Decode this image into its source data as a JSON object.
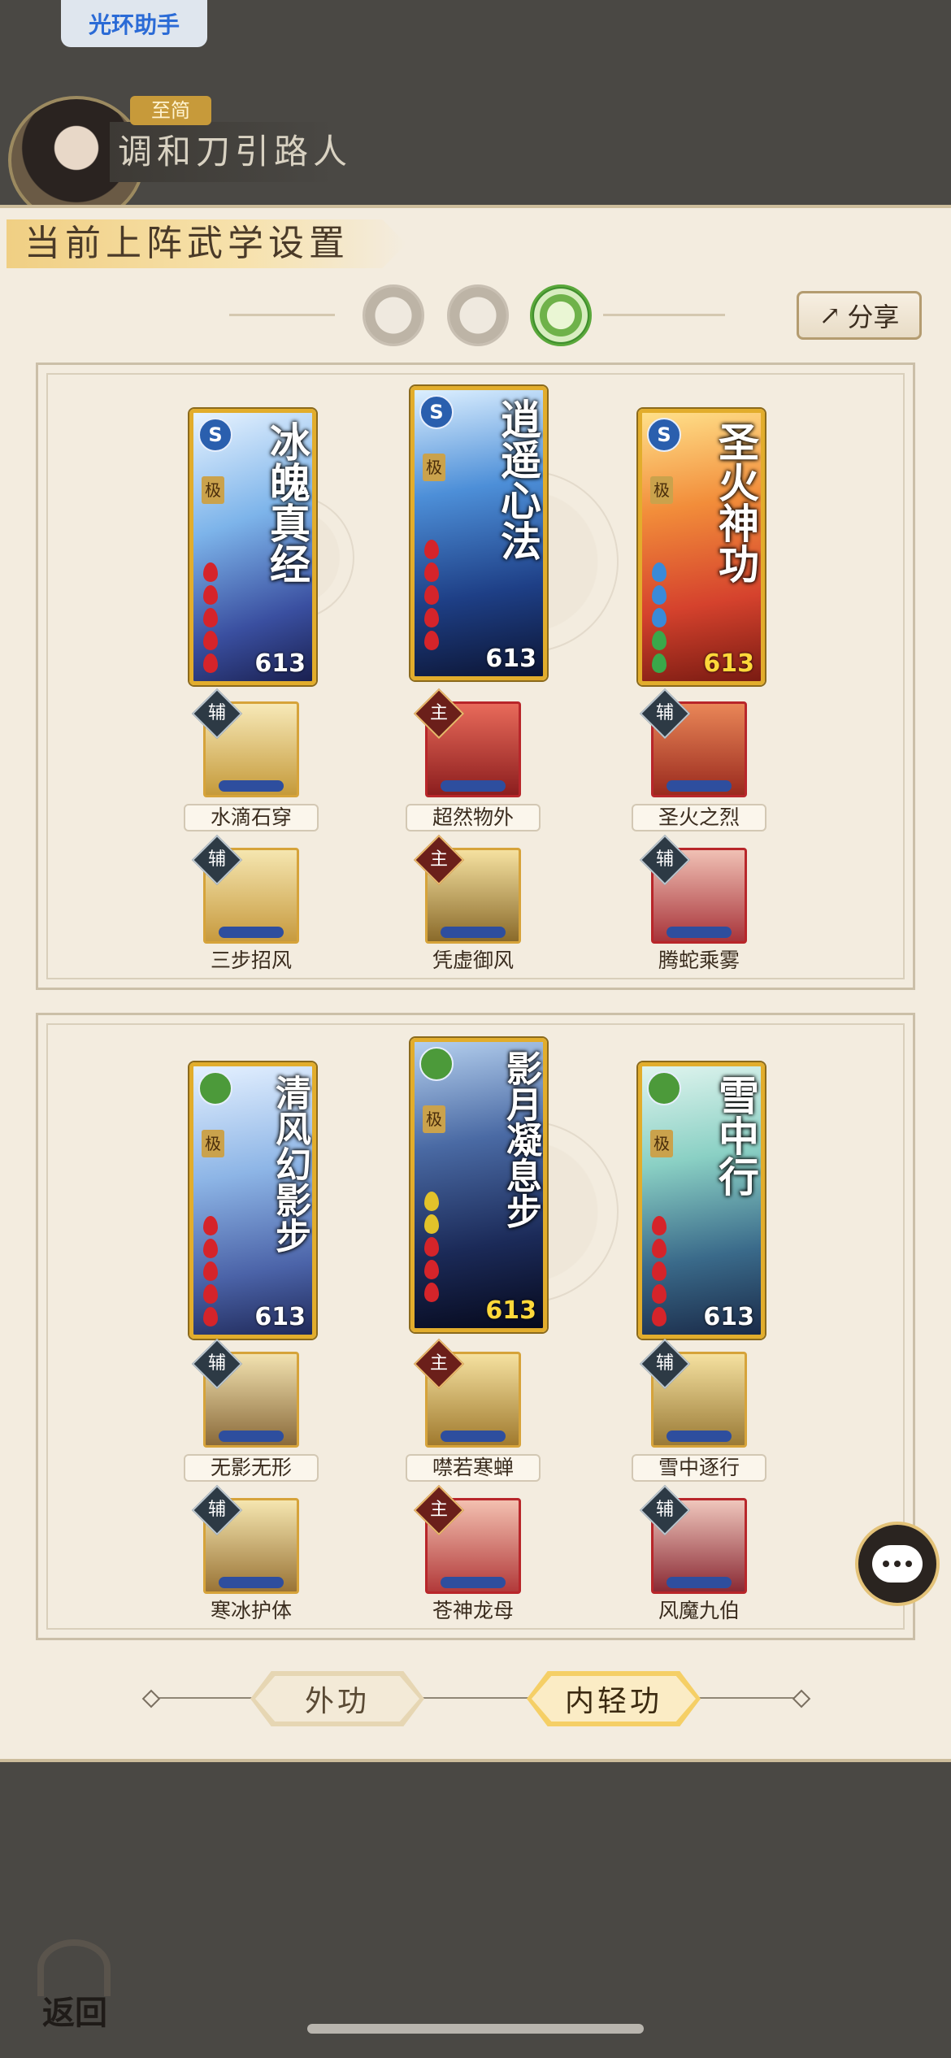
{
  "top": {
    "halo_button": "光环助手",
    "rank": "至简",
    "player_name": "调和刀引路人"
  },
  "panel": {
    "title": "当前上阵武学设置",
    "share_label": "分享",
    "mode_icons": [
      "moon-icon",
      "sun-icon",
      "jade-icon"
    ],
    "active_mode": 2
  },
  "sections": [
    {
      "cards": [
        {
          "name": "冰魄真经",
          "grade": "极",
          "level": "613",
          "badge": "S"
        },
        {
          "name": "逍遥心法",
          "grade": "极",
          "level": "613",
          "badge": "S"
        },
        {
          "name": "圣火神功",
          "grade": "极",
          "level": "613",
          "badge": "S"
        }
      ],
      "skills_row1": [
        {
          "tag": "辅",
          "label": "水滴石穿"
        },
        {
          "tag": "主",
          "label": "超然物外"
        },
        {
          "tag": "辅",
          "label": "圣火之烈"
        }
      ],
      "skills_row2": [
        {
          "tag": "辅",
          "label": "三步招风"
        },
        {
          "tag": "主",
          "label": "凭虚御风"
        },
        {
          "tag": "辅",
          "label": "腾蛇乘雾"
        }
      ]
    },
    {
      "cards": [
        {
          "name": "清风幻影步",
          "grade": "极",
          "level": "613"
        },
        {
          "name": "影月凝息步",
          "grade": "极",
          "level": "613"
        },
        {
          "name": "雪中行",
          "grade": "极",
          "level": "613"
        }
      ],
      "skills_row1": [
        {
          "tag": "辅",
          "label": "无影无形"
        },
        {
          "tag": "主",
          "label": "噤若寒蝉"
        },
        {
          "tag": "辅",
          "label": "雪中逐行"
        }
      ],
      "skills_row2": [
        {
          "tag": "辅",
          "label": "寒冰护体"
        },
        {
          "tag": "主",
          "label": "苍神龙母"
        },
        {
          "tag": "辅",
          "label": "风魔九伯"
        }
      ]
    }
  ],
  "bottom_tabs": {
    "outer": "外功",
    "inner": "内轻功",
    "active": "inner"
  },
  "back_label": "返回",
  "colors": {
    "panel_bg": "#f3ecdf",
    "card_border": "#e2ad2c",
    "active_mode": "#5aa83b",
    "level_gold": "#ffd83a"
  }
}
